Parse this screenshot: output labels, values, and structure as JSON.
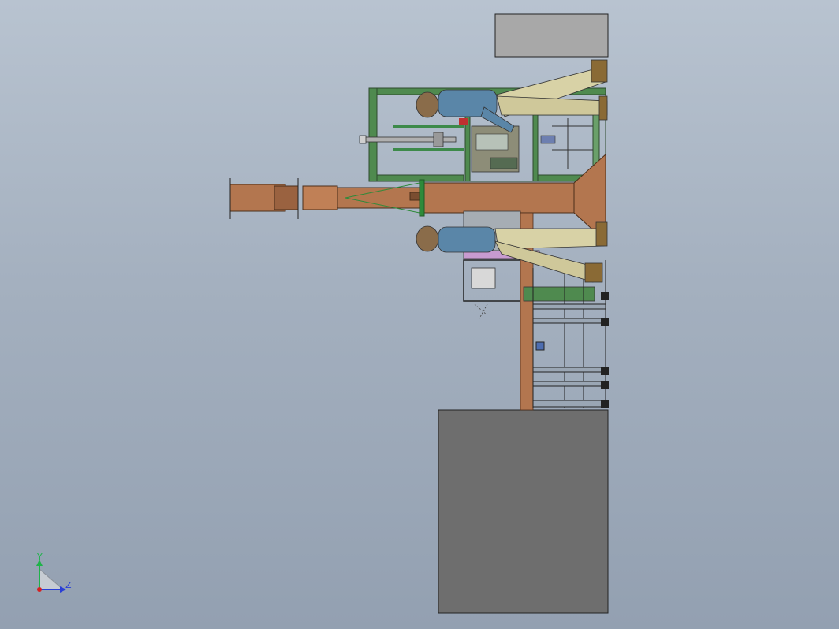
{
  "viewport": {
    "background_top": "#b8c3d0",
    "background_bottom": "#93a0b1"
  },
  "triad": {
    "y_label": "Y",
    "z_label": "Z",
    "y_color": "#1fb34a",
    "z_color": "#2a3fd6",
    "origin_color": "#d62020"
  },
  "colors": {
    "frame_green": "#4f8a4f",
    "pipe_brown": "#b3764f",
    "panel_light": "#a8a8a8",
    "panel_dark": "#6e6e6e",
    "worker_shirt": "#5a86a8",
    "worker_pants": "#d8d2a6",
    "platform_pink": "#c89bd0"
  }
}
